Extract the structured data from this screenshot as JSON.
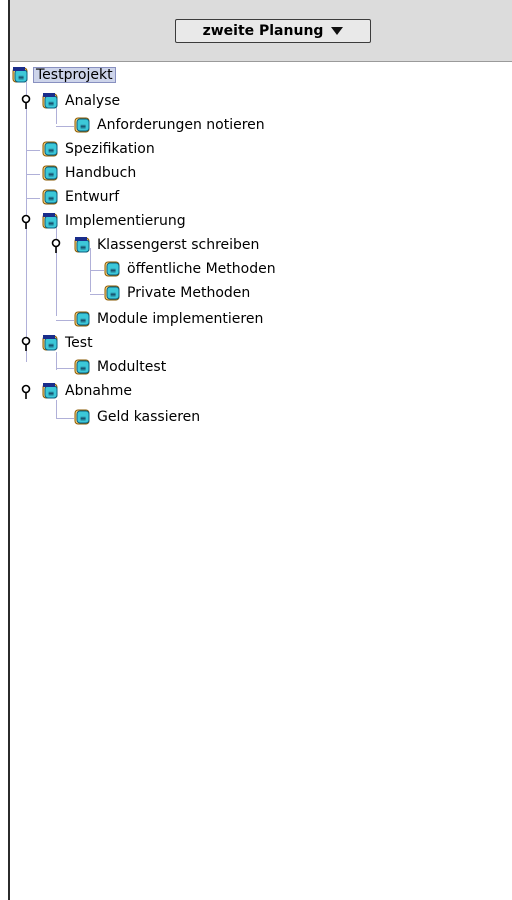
{
  "header": {
    "dropdown_label": "zweite Planung"
  },
  "tree": {
    "root": "Testprojekt",
    "analyse": "Analyse",
    "anforderungen": "Anforderungen notieren",
    "spezifikation": "Spezifikation",
    "handbuch": "Handbuch",
    "entwurf": "Entwurf",
    "implementierung": "Implementierung",
    "klassengerst": "Klassengerst schreiben",
    "oeffentliche": "öffentliche Methoden",
    "private": "Private Methoden",
    "module": "Module implementieren",
    "test": "Test",
    "modultest": "Modultest",
    "abnahme": "Abnahme",
    "geld": "Geld kassieren"
  },
  "colors": {
    "header_bg": "#dcdcdc",
    "selection": "#cdd4ea",
    "tree_lines": "#b0b0d8"
  },
  "icons": {
    "leaf": "task-icon",
    "folder": "task-group-icon",
    "toggle": "tree-expander-icon"
  }
}
